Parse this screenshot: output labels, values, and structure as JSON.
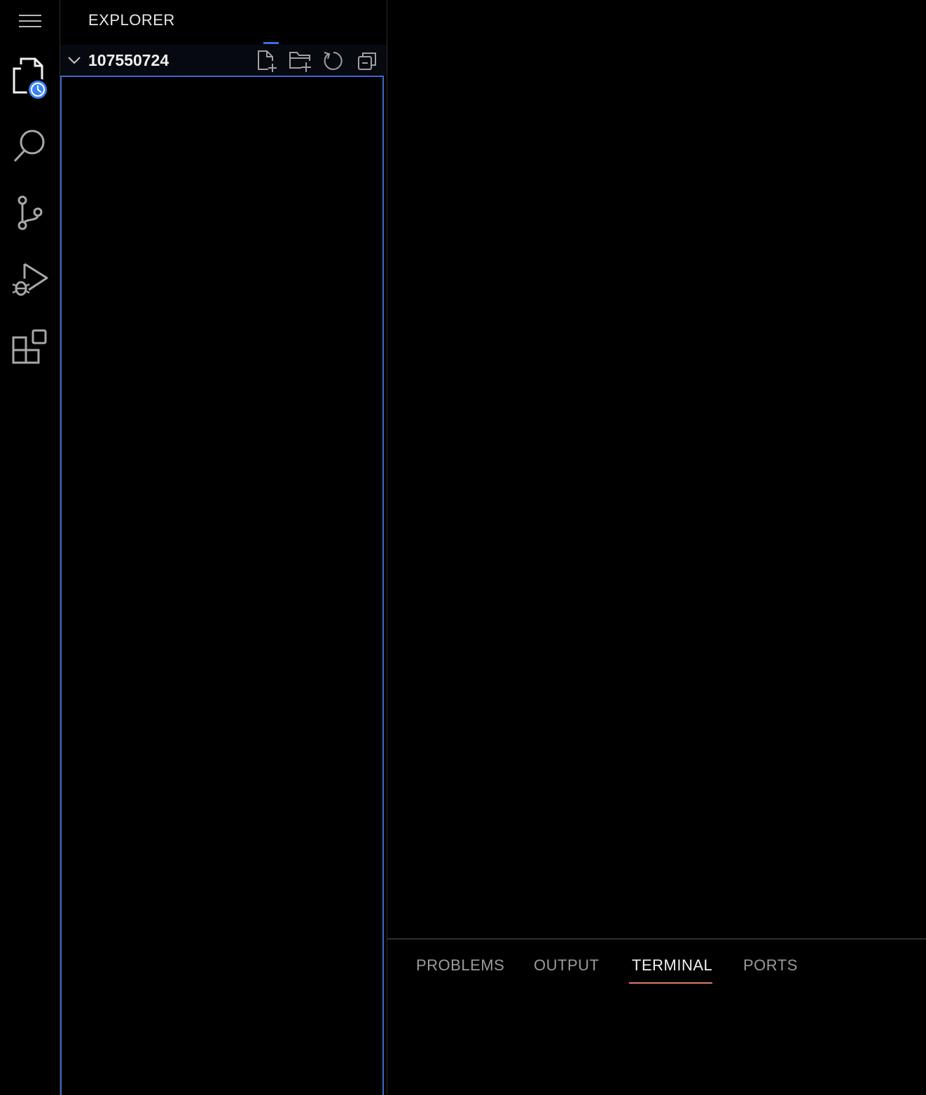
{
  "activity_bar": {
    "items": [
      {
        "name": "menu",
        "icon": "hamburger-menu-icon"
      },
      {
        "name": "explorer",
        "icon": "files-icon",
        "badge_icon": "clock-icon"
      },
      {
        "name": "search",
        "icon": "search-icon"
      },
      {
        "name": "source-control",
        "icon": "source-control-icon"
      },
      {
        "name": "run-and-debug",
        "icon": "run-debug-icon"
      },
      {
        "name": "extensions",
        "icon": "extensions-icon"
      }
    ]
  },
  "sidebar": {
    "title": "EXPLORER",
    "folder": {
      "name": "107550724",
      "expanded": true,
      "actions": [
        "new-file-icon",
        "new-folder-icon",
        "refresh-icon",
        "collapse-all-icon"
      ]
    }
  },
  "panel": {
    "tabs": [
      {
        "label": "PROBLEMS",
        "active": false
      },
      {
        "label": "OUTPUT",
        "active": false
      },
      {
        "label": "TERMINAL",
        "active": true
      },
      {
        "label": "PORTS",
        "active": false
      }
    ]
  },
  "colors": {
    "background": "#000000",
    "focus_border": "#3b6ac9",
    "active_tab_underline": "#e07a6a",
    "badge": "#3b82f6"
  }
}
